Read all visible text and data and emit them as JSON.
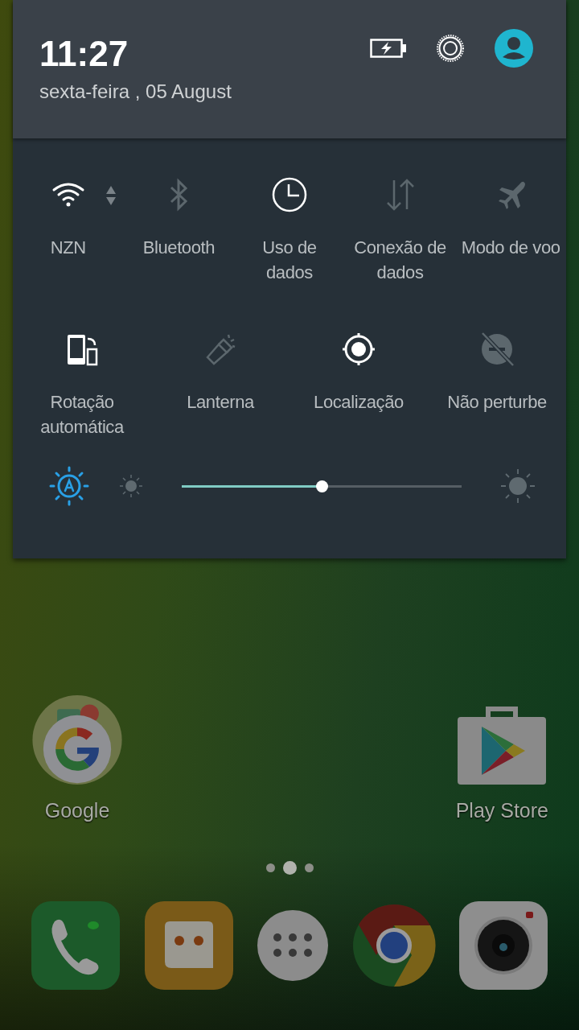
{
  "header": {
    "time": "11:27",
    "date": "sexta-feira , 05 August"
  },
  "tile_rows": [
    [
      {
        "kind": "wifi",
        "label": "NZN",
        "on": true
      },
      {
        "kind": "bluetooth",
        "label": "Bluetooth",
        "on": false
      },
      {
        "kind": "data-usage",
        "label": "Uso de dados",
        "on": true
      },
      {
        "kind": "mobile-data",
        "label": "Conexão de dados",
        "on": false
      },
      {
        "kind": "airplane",
        "label": "Modo de voo",
        "on": false
      }
    ],
    [
      {
        "kind": "rotation",
        "label": "Rotação automática",
        "on": true
      },
      {
        "kind": "flashlight",
        "label": "Lanterna",
        "on": false
      },
      {
        "kind": "location",
        "label": "Localização",
        "on": true
      },
      {
        "kind": "dnd",
        "label": "Não perturbe",
        "on": false
      }
    ]
  ],
  "brightness": {
    "auto": true,
    "level": 0.5
  },
  "home": {
    "apps": [
      {
        "kind": "folder",
        "label": "Google"
      },
      {
        "kind": "store",
        "label": "Play Store"
      }
    ],
    "pages": [
      {
        "selected": false
      },
      {
        "selected": true
      },
      {
        "selected": false
      }
    ]
  }
}
